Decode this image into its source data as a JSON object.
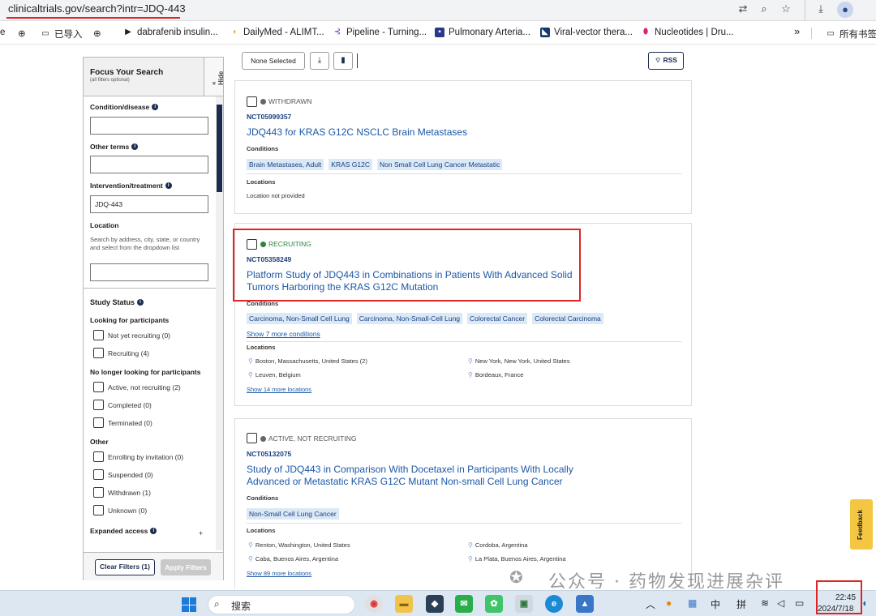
{
  "browser": {
    "url": "clinicaltrials.gov/search?intr=JDQ-443",
    "bookmarks": [
      {
        "label": "已导入",
        "icon": "folder-icon",
        "color": "#444444"
      },
      {
        "label": "dabrafenib insulin...",
        "icon": "play-icon",
        "color": "#222222"
      },
      {
        "label": "DailyMed - ALIMT...",
        "icon": "pill-icon",
        "color": "#f0a020"
      },
      {
        "label": "Pipeline - Turning...",
        "icon": "pipeline-icon",
        "color": "#6a2fb0"
      },
      {
        "label": "Pulmonary Arteria...",
        "icon": "site-icon",
        "color": "#2a3a8a"
      },
      {
        "label": "Viral-vector thera...",
        "icon": "site-icon",
        "color": "#123a6a"
      },
      {
        "label": "Nucleotides | Dru...",
        "icon": "capsule-icon",
        "color": "#e0207a"
      }
    ],
    "bookmarks_more": "»",
    "all_bookmarks": "所有书签",
    "left_cut": "e"
  },
  "toolbar": {
    "none_selected": "None Selected",
    "rss": "RSS"
  },
  "sidebar": {
    "title": "Focus Your Search",
    "subtitle": "(all filters optional)",
    "hide": "« Hide",
    "condition_label": "Condition/disease",
    "other_terms_label": "Other terms",
    "intervention_label": "Intervention/treatment",
    "intervention_value": "JDQ-443",
    "location_label": "Location",
    "location_help": "Search by address, city, state, or country and select from the dropdown list",
    "study_status_label": "Study Status",
    "looking_label": "Looking for participants",
    "looking": [
      {
        "label": "Not yet recruiting (0)"
      },
      {
        "label": "Recruiting (4)"
      }
    ],
    "no_longer_label": "No longer looking for participants",
    "no_longer": [
      {
        "label": "Active, not recruiting (2)"
      },
      {
        "label": "Completed (0)"
      },
      {
        "label": "Terminated (0)"
      }
    ],
    "other_label": "Other",
    "other": [
      {
        "label": "Enrolling by invitation (0)"
      },
      {
        "label": "Suspended (0)"
      },
      {
        "label": "Withdrawn (1)"
      },
      {
        "label": "Unknown (0)"
      }
    ],
    "expanded_access_label": "Expanded access",
    "expanded_plus": "+",
    "clear_filters": "Clear Filters (1)",
    "apply_filters": "Apply Filters"
  },
  "studies": [
    {
      "status": "WITHDRAWN",
      "status_color": "#666666",
      "nct": "NCT05999357",
      "title": "JDQ443 for KRAS G12C NSCLC Brain Metastases",
      "conditions_label": "Conditions",
      "conditions": [
        "Brain Metastases, Adult",
        "KRAS G12C",
        "Non Small Cell Lung Cancer Metastatic"
      ],
      "locations_label": "Locations",
      "location_text": "Location not provided"
    },
    {
      "status": "RECRUITING",
      "status_color": "#2e8540",
      "nct": "NCT05358249",
      "title": "Platform Study of JDQ443 in Combinations in Patients With Advanced Solid Tumors Harboring the KRAS G12C Mutation",
      "conditions_label": "Conditions",
      "conditions": [
        "Carcinoma, Non-Small Cell Lung",
        "Carcinoma, Non-Small-Cell Lung",
        "Colorectal Cancer",
        "Colorectal Carcinoma"
      ],
      "more_conditions": "Show 7 more conditions",
      "locations_label": "Locations",
      "locations": [
        "Boston, Massachusetts, United States (2)",
        "New York, New York, United States",
        "Leuven, Belgium",
        "Bordeaux, France"
      ],
      "more_locations": "Show 14 more locations"
    },
    {
      "status": "ACTIVE, NOT RECRUITING",
      "status_color": "#666666",
      "nct": "NCT05132075",
      "title": "Study of JDQ443 in Comparison With Docetaxel in Participants With Locally Advanced or Metastatic KRAS G12C Mutant Non-small Cell Lung Cancer",
      "conditions_label": "Conditions",
      "conditions": [
        "Non-Small Cell Lung Cancer"
      ],
      "locations_label": "Locations",
      "locations": [
        "Renton, Washington, United States",
        "Cordoba, Argentina",
        "Caba, Buenos Aires, Argentina",
        "La Plata, Buenos Aires, Argentina"
      ],
      "more_locations": "Show 89 more locations"
    }
  ],
  "feedback": "Feedback",
  "watermark": "公众号 · 药物发现进展杂评",
  "taskbar": {
    "search_placeholder": "搜索",
    "ime1": "中",
    "ime2": "拼",
    "time": "22:45",
    "date": "2024/7/18"
  }
}
